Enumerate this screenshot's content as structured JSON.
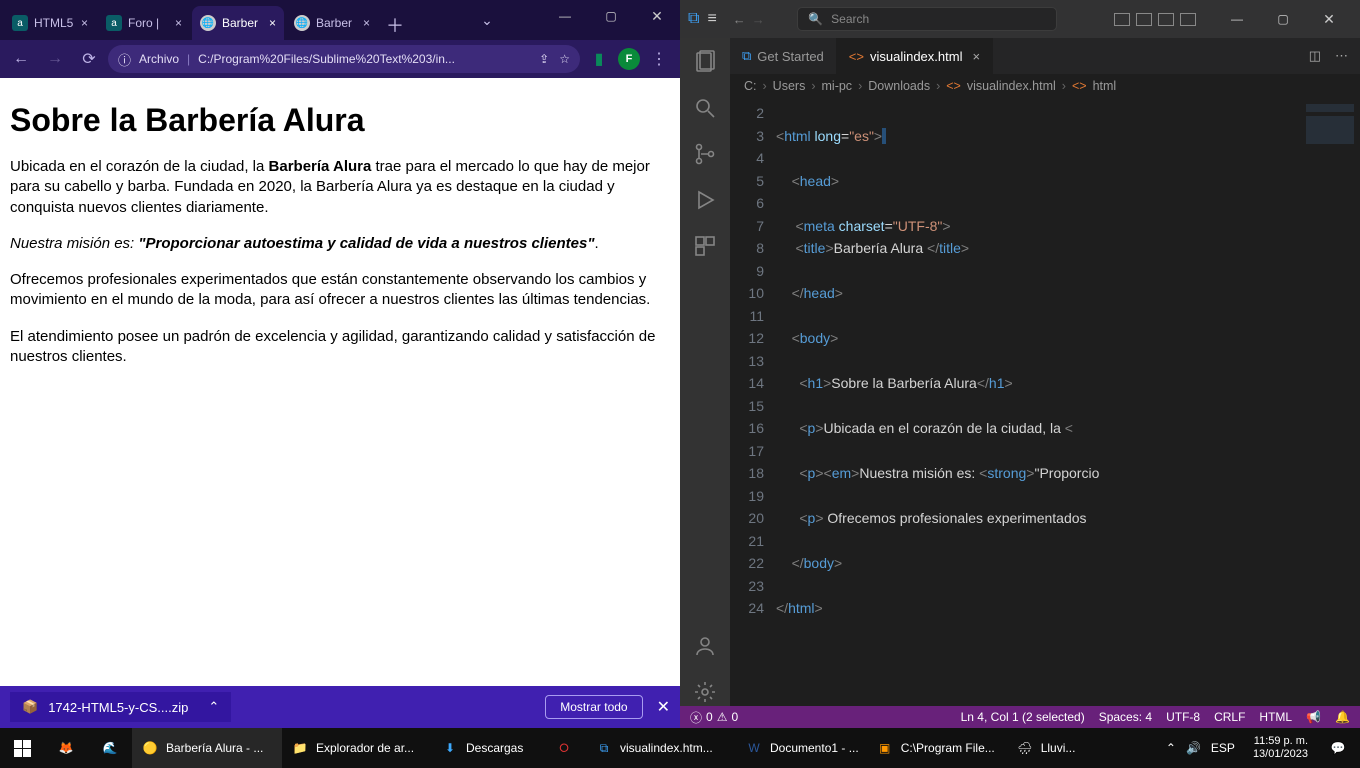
{
  "browser": {
    "tabs": [
      {
        "label": "HTML5",
        "fav": "a"
      },
      {
        "label": "Foro |",
        "fav": "a"
      },
      {
        "label": "Barber",
        "fav": "globe",
        "active": true
      },
      {
        "label": "Barber",
        "fav": "globe"
      }
    ],
    "addr_prefix": "Archivo",
    "addr_path": "C:/Program%20Files/Sublime%20Text%203/in...",
    "profile_letter": "F",
    "download_file": "1742-HTML5-y-CS....zip",
    "download_show_all": "Mostrar todo"
  },
  "page": {
    "h1": "Sobre la Barbería Alura",
    "p1_a": "Ubicada en el corazón de la ciudad, la ",
    "p1_b": "Barbería Alura",
    "p1_c": " trae para el mercado lo que hay de mejor para su cabello y barba. Fundada en 2020, la Barbería Alura ya es destaque en la ciudad y conquista nuevos clientes diariamente.",
    "p2_a": "Nuestra misión es: ",
    "p2_b": "\"Proporcionar autoestima y calidad de vida a nuestros clientes\"",
    "p2_c": ".",
    "p3": "Ofrecemos profesionales experimentados que están constantemente observando los cambios y movimiento en el mundo de la moda, para así ofrecer a nuestros clientes las últimas tendencias.",
    "p4": "El atendimiento posee un padrón de excelencia y agilidad, garantizando calidad y satisfacción de nuestros clientes."
  },
  "vscode": {
    "search_placeholder": "Search",
    "tabs": {
      "get_started": "Get Started",
      "file": "visualindex.html"
    },
    "breadcrumbs": {
      "c": "C:",
      "users": "Users",
      "mi_pc": "mi-pc",
      "downloads": "Downloads",
      "file": "visualindex.html",
      "html": "html"
    },
    "status": {
      "errors": "0",
      "warnings": "0",
      "pos": "Ln 4, Col 1 (2 selected)",
      "spaces": "Spaces: 4",
      "enc": "UTF-8",
      "eol": "CRLF",
      "lang": "HTML"
    },
    "code": {
      "l3_attr": "long",
      "l3_val": "\"es\"",
      "l7_attr": "charset",
      "l7_val": "\"UTF-8\"",
      "l8_text": "Barbería Alura ",
      "l14_text": "Sobre la Barbería Alura",
      "l16_text": "Ubicada en el corazón de la ciudad, la ",
      "l18_text": "Nuestra misión es: ",
      "l18_strong": "\"Proporcio",
      "l20_text": " Ofrecemos profesionales experimentados "
    },
    "lines": [
      "2",
      "3",
      "4",
      "5",
      "6",
      "7",
      "8",
      "9",
      "10",
      "11",
      "12",
      "13",
      "14",
      "15",
      "16",
      "17",
      "18",
      "19",
      "20",
      "21",
      "22",
      "23",
      "24"
    ]
  },
  "taskbar": {
    "apps": {
      "chrome": "Barbería Alura - ...",
      "explorer": "Explorador de ar...",
      "downloads": "Descargas",
      "vscode": "visualindex.htm...",
      "word": "Documento1 - ...",
      "sublime": "C:\\Program File...",
      "weather": "Lluvi..."
    },
    "lang": "ESP",
    "time": "11:59 p. m.",
    "date": "13/01/2023"
  }
}
